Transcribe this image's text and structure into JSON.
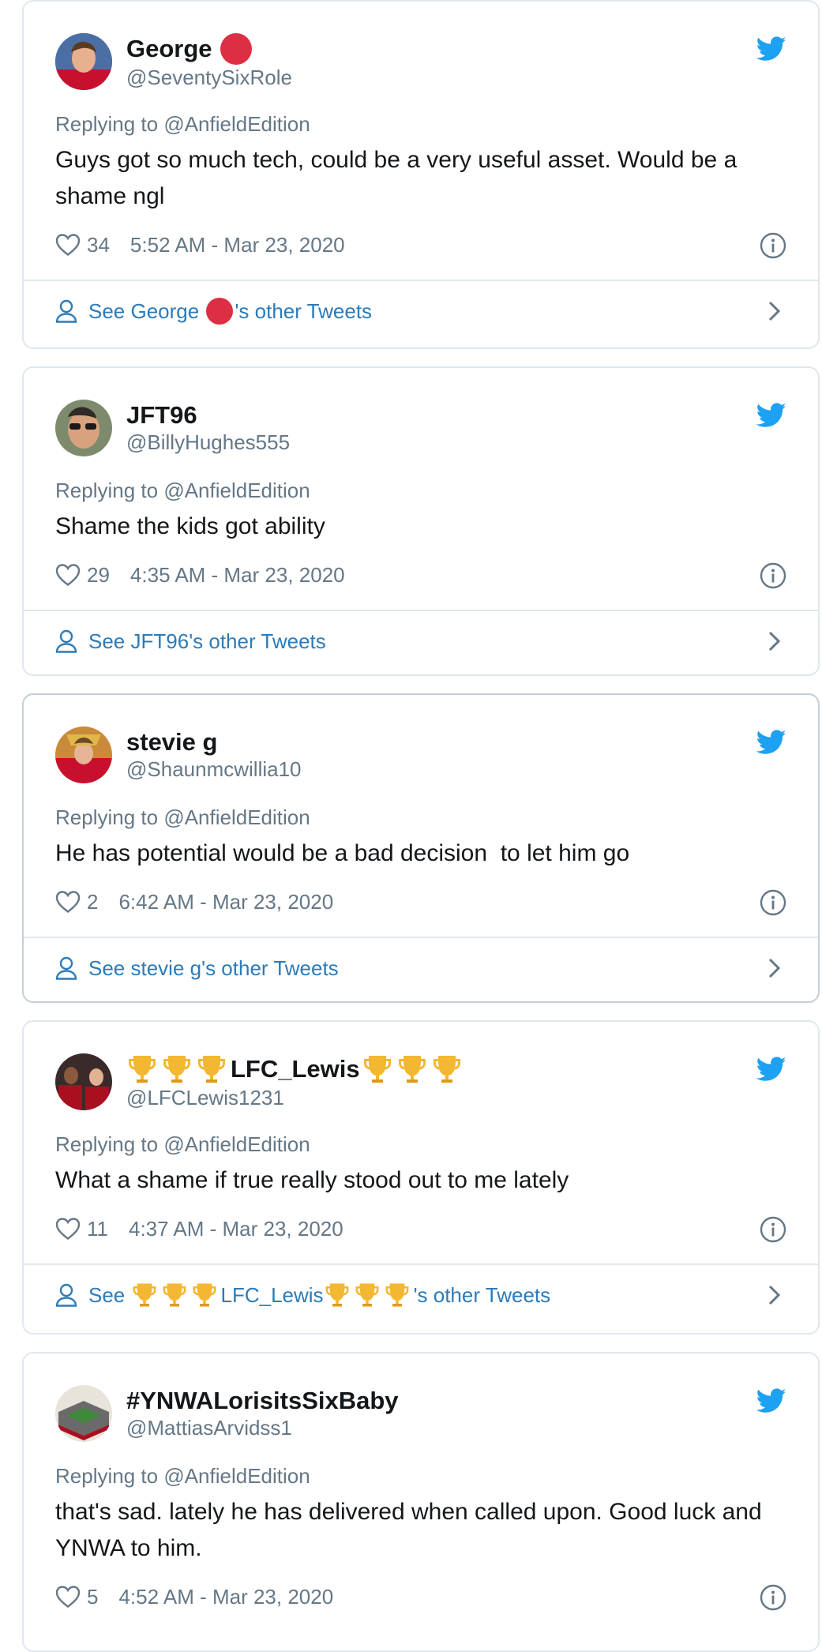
{
  "reply_prefix": "Replying to",
  "see_prefix": "See",
  "see_suffix": "'s other Tweets",
  "colors": {
    "twitter_blue": "#1da1f2",
    "link_blue": "#2b7bb9",
    "muted": "#657786",
    "text": "#14171a",
    "red_circle": "#dd2e44",
    "trophy": "#f4b731"
  },
  "tweets": [
    {
      "display_name": "George",
      "name_emoji": "red-circle",
      "handle": "@SeventySixRole",
      "replying_to": "@AnfieldEdition",
      "text": "Guys got so much tech, could be a very useful asset. Would be a shame ngl",
      "likes": "34",
      "timestamp": "5:52 AM - Mar 23, 2020",
      "footer_name": "George"
    },
    {
      "display_name": "JFT96",
      "handle": "@BillyHughes555",
      "replying_to": "@AnfieldEdition",
      "text": "Shame the kids got ability",
      "likes": "29",
      "timestamp": "4:35 AM - Mar 23, 2020",
      "footer_name": "JFT96"
    },
    {
      "display_name": "stevie g",
      "handle": "@Shaunmcwillia10",
      "replying_to": "@AnfieldEdition",
      "text": "He has potential would be a bad decision  to let him go",
      "likes": "2",
      "timestamp": "6:42 AM - Mar 23, 2020",
      "footer_name": "stevie g"
    },
    {
      "display_name": "LFC_Lewis",
      "name_emoji": "trophy x3 both sides",
      "handle": "@LFCLewis1231",
      "replying_to": "@AnfieldEdition",
      "text": "What a shame if true really stood out to me lately",
      "likes": "11",
      "timestamp": "4:37 AM - Mar 23, 2020",
      "footer_name": "LFC_Lewis"
    },
    {
      "display_name": "#YNWALorisitsSixBaby",
      "handle": "@MattiasArvidss1",
      "replying_to": "@AnfieldEdition",
      "text": "that's sad. lately he has delivered when called upon. Good luck and YNWA to him.",
      "likes": "5",
      "timestamp": "4:52 AM - Mar 23, 2020"
    }
  ]
}
